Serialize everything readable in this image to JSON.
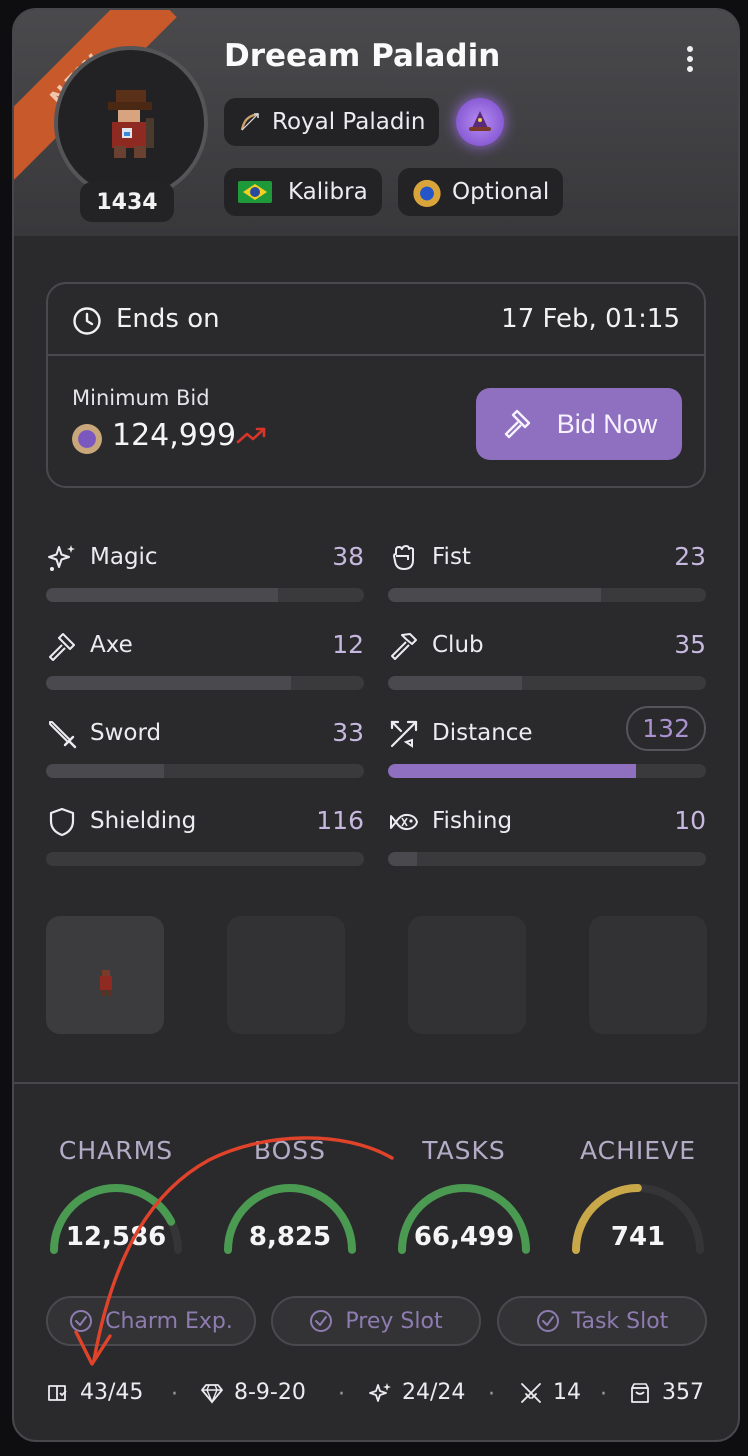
{
  "header": {
    "ribbon": "NEW",
    "level": "1434",
    "name": "Dreeam Paladin",
    "vocation": "Royal Paladin",
    "world": "Kalibra",
    "pvp": "Optional",
    "icons": {
      "vocation": "bow-icon",
      "extra": "wizard-hat-icon",
      "world": "brazil-flag-icon",
      "pvp": "amulet-icon",
      "menu": "kebab-menu-icon"
    }
  },
  "auction": {
    "ends_label": "Ends on",
    "ends_date": "17 Feb, 01:15",
    "min_bid_label": "Minimum Bid",
    "min_bid_value": "124,999",
    "bid_button": "Bid Now",
    "icons": {
      "clock": "clock-icon",
      "coin": "tibia-coin-icon",
      "trend": "trend-up-icon",
      "gavel": "gavel-icon"
    }
  },
  "skills": [
    {
      "label": "Magic",
      "value": "38",
      "progress": 0.73,
      "icon": "sparkles-icon"
    },
    {
      "label": "Fist",
      "value": "23",
      "progress": 0.67,
      "icon": "fist-icon"
    },
    {
      "label": "Axe",
      "value": "12",
      "progress": 0.77,
      "icon": "axe-icon"
    },
    {
      "label": "Club",
      "value": "35",
      "progress": 0.42,
      "icon": "hammer-icon"
    },
    {
      "label": "Sword",
      "value": "33",
      "progress": 0.37,
      "icon": "sword-icon"
    },
    {
      "label": "Distance",
      "value": "132",
      "progress": 0.78,
      "icon": "arrows-icon",
      "highlight": true
    },
    {
      "label": "Shielding",
      "value": "116",
      "progress": 0.0,
      "icon": "shield-icon"
    },
    {
      "label": "Fishing",
      "value": "10",
      "progress": 0.09,
      "icon": "fish-icon"
    }
  ],
  "gauges": [
    {
      "title": "CHARMS",
      "value": "12,586",
      "fraction": 0.85,
      "color": "#4a9a52"
    },
    {
      "title": "BOSS",
      "value": "8,825",
      "fraction": 1.0,
      "color": "#4a9a52"
    },
    {
      "title": "TASKS",
      "value": "66,499",
      "fraction": 1.0,
      "color": "#4a9a52"
    },
    {
      "title": "ACHIEVE",
      "value": "741",
      "fraction": 0.5,
      "color": "#c9a84a"
    }
  ],
  "perks": [
    {
      "label": "Charm Exp.",
      "icon": "check-circle-icon"
    },
    {
      "label": "Prey Slot",
      "icon": "check-circle-icon"
    },
    {
      "label": "Task Slot",
      "icon": "check-circle-icon"
    }
  ],
  "stats": [
    {
      "value": "43/45",
      "icon": "book-icon"
    },
    {
      "value": "8-9-20",
      "icon": "gem-icon"
    },
    {
      "value": "24/24",
      "icon": "sparkles-icon"
    },
    {
      "value": "14",
      "icon": "crossed-swords-icon"
    },
    {
      "value": "357",
      "icon": "bag-icon"
    }
  ],
  "colors": {
    "accent": "#8e6fc0",
    "ribbon": "#c8592b",
    "annotation": "#e0432a"
  }
}
